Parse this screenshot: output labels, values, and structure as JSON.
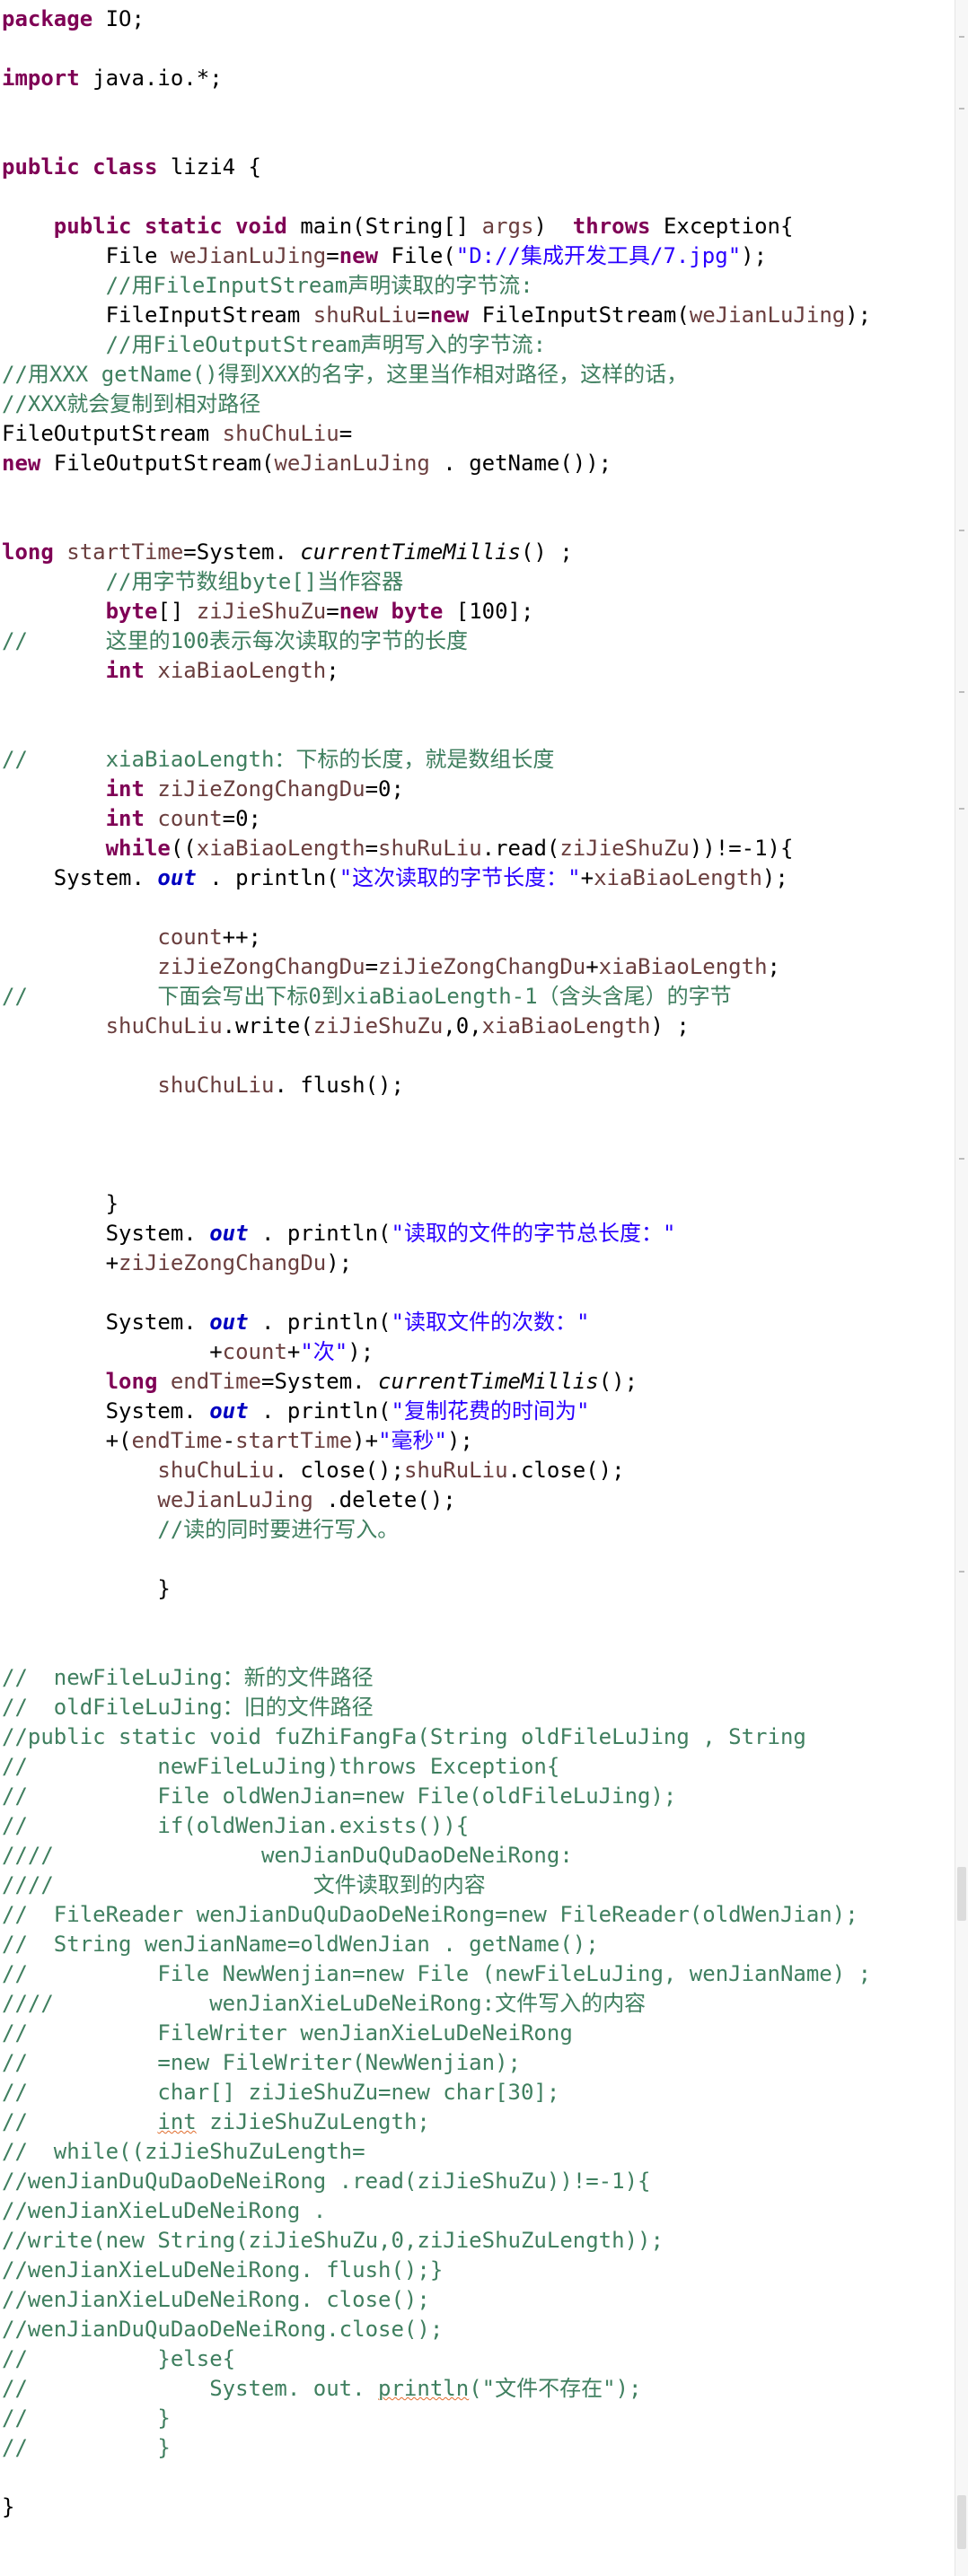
{
  "editor": {
    "lines": [
      [
        {
          "c": "kw",
          "t": "package"
        },
        {
          "c": "plain",
          "t": " IO;"
        }
      ],
      [],
      [
        {
          "c": "kw",
          "t": "import"
        },
        {
          "c": "plain",
          "t": " java.io.*;"
        }
      ],
      [],
      [],
      [
        {
          "c": "kw",
          "t": "public class"
        },
        {
          "c": "plain",
          "t": " lizi4 {"
        }
      ],
      [],
      [
        {
          "c": "plain",
          "t": "    "
        },
        {
          "c": "kw",
          "t": "public static void"
        },
        {
          "c": "plain",
          "t": " main(String[] "
        },
        {
          "c": "var",
          "t": "args"
        },
        {
          "c": "plain",
          "t": ")  "
        },
        {
          "c": "kw",
          "t": "throws"
        },
        {
          "c": "plain",
          "t": " Exception{"
        }
      ],
      [
        {
          "c": "plain",
          "t": "        File "
        },
        {
          "c": "var",
          "t": "weJianLuJing"
        },
        {
          "c": "plain",
          "t": "="
        },
        {
          "c": "kw",
          "t": "new"
        },
        {
          "c": "plain",
          "t": " File("
        },
        {
          "c": "st",
          "t": "\"D://集成开发工具/7.jpg\""
        },
        {
          "c": "plain",
          "t": ");"
        }
      ],
      [
        {
          "c": "plain",
          "t": "        "
        },
        {
          "c": "cm",
          "t": "//用FileInputStream声明读取的字节流:"
        }
      ],
      [
        {
          "c": "plain",
          "t": "        FileInputStream "
        },
        {
          "c": "var",
          "t": "shuRuLiu"
        },
        {
          "c": "plain",
          "t": "="
        },
        {
          "c": "kw",
          "t": "new"
        },
        {
          "c": "plain",
          "t": " FileInputStream("
        },
        {
          "c": "var",
          "t": "weJianLuJing"
        },
        {
          "c": "plain",
          "t": ");"
        }
      ],
      [
        {
          "c": "plain",
          "t": "        "
        },
        {
          "c": "cm",
          "t": "//用FileOutputStream声明写入的字节流:"
        }
      ],
      [
        {
          "c": "cm",
          "t": "//用XXX getName()得到XXX的名字，这里当作相对路径，这样的话，"
        }
      ],
      [
        {
          "c": "cm",
          "t": "//XXX就会复制到相对路径"
        }
      ],
      [
        {
          "c": "plain",
          "t": "FileOutputStream "
        },
        {
          "c": "var",
          "t": "shuChuLiu"
        },
        {
          "c": "plain",
          "t": "="
        }
      ],
      [
        {
          "c": "kw",
          "t": "new"
        },
        {
          "c": "plain",
          "t": " FileOutputStream("
        },
        {
          "c": "var",
          "t": "weJianLuJing"
        },
        {
          "c": "plain",
          "t": " . getName());"
        }
      ],
      [],
      [],
      [
        {
          "c": "kw",
          "t": "long"
        },
        {
          "c": "plain",
          "t": " "
        },
        {
          "c": "var",
          "t": "startTime"
        },
        {
          "c": "plain",
          "t": "=System. "
        },
        {
          "c": "it",
          "t": "currentTimeMillis"
        },
        {
          "c": "plain",
          "t": "() ;"
        }
      ],
      [
        {
          "c": "plain",
          "t": "        "
        },
        {
          "c": "cm",
          "t": "//用字节数组byte[]当作容器"
        }
      ],
      [
        {
          "c": "plain",
          "t": "        "
        },
        {
          "c": "kw",
          "t": "byte"
        },
        {
          "c": "plain",
          "t": "[] "
        },
        {
          "c": "var",
          "t": "ziJieShuZu"
        },
        {
          "c": "plain",
          "t": "="
        },
        {
          "c": "kw",
          "t": "new byte"
        },
        {
          "c": "plain",
          "t": " [100];"
        }
      ],
      [
        {
          "c": "cm",
          "t": "//      这里的100表示每次读取的字节的长度"
        }
      ],
      [
        {
          "c": "plain",
          "t": "        "
        },
        {
          "c": "kw",
          "t": "int"
        },
        {
          "c": "plain",
          "t": " "
        },
        {
          "c": "var",
          "t": "xiaBiaoLength"
        },
        {
          "c": "plain",
          "t": ";"
        }
      ],
      [],
      [],
      [
        {
          "c": "cm",
          "t": "//      xiaBiaoLength：下标的长度，就是数组长度"
        }
      ],
      [
        {
          "c": "plain",
          "t": "        "
        },
        {
          "c": "kw",
          "t": "int"
        },
        {
          "c": "plain",
          "t": " "
        },
        {
          "c": "var",
          "t": "ziJieZongChangDu"
        },
        {
          "c": "plain",
          "t": "=0;"
        }
      ],
      [
        {
          "c": "plain",
          "t": "        "
        },
        {
          "c": "kw",
          "t": "int"
        },
        {
          "c": "plain",
          "t": " "
        },
        {
          "c": "var",
          "t": "count"
        },
        {
          "c": "plain",
          "t": "=0;"
        }
      ],
      [
        {
          "c": "plain",
          "t": "        "
        },
        {
          "c": "kw",
          "t": "while"
        },
        {
          "c": "plain",
          "t": "(("
        },
        {
          "c": "var",
          "t": "xiaBiaoLength"
        },
        {
          "c": "plain",
          "t": "="
        },
        {
          "c": "var",
          "t": "shuRuLiu"
        },
        {
          "c": "plain",
          "t": ".read("
        },
        {
          "c": "var",
          "t": "ziJieShuZu"
        },
        {
          "c": "plain",
          "t": "))!=-1){"
        }
      ],
      [
        {
          "c": "plain",
          "t": "    System. "
        },
        {
          "c": "fd",
          "t": "out"
        },
        {
          "c": "plain",
          "t": " . println("
        },
        {
          "c": "st",
          "t": "\"这次读取的字节长度：\""
        },
        {
          "c": "plain",
          "t": "+"
        },
        {
          "c": "var",
          "t": "xiaBiaoLength"
        },
        {
          "c": "plain",
          "t": ");"
        }
      ],
      [],
      [
        {
          "c": "plain",
          "t": "            "
        },
        {
          "c": "var",
          "t": "count"
        },
        {
          "c": "plain",
          "t": "++;"
        }
      ],
      [
        {
          "c": "plain",
          "t": "            "
        },
        {
          "c": "var",
          "t": "ziJieZongChangDu"
        },
        {
          "c": "plain",
          "t": "="
        },
        {
          "c": "var",
          "t": "ziJieZongChangDu"
        },
        {
          "c": "plain",
          "t": "+"
        },
        {
          "c": "var",
          "t": "xiaBiaoLength"
        },
        {
          "c": "plain",
          "t": ";"
        }
      ],
      [
        {
          "c": "cm",
          "t": "//          下面会写出下标0到xiaBiaoLength-1（含头含尾）的字节"
        }
      ],
      [
        {
          "c": "plain",
          "t": "        "
        },
        {
          "c": "var",
          "t": "shuChuLiu"
        },
        {
          "c": "plain",
          "t": ".write("
        },
        {
          "c": "var",
          "t": "ziJieShuZu"
        },
        {
          "c": "plain",
          "t": ",0,"
        },
        {
          "c": "var",
          "t": "xiaBiaoLength"
        },
        {
          "c": "plain",
          "t": ") ;"
        }
      ],
      [],
      [
        {
          "c": "plain",
          "t": "            "
        },
        {
          "c": "var",
          "t": "shuChuLiu"
        },
        {
          "c": "plain",
          "t": ". flush();"
        }
      ],
      [],
      [],
      [],
      [
        {
          "c": "plain",
          "t": "        }"
        }
      ],
      [
        {
          "c": "plain",
          "t": "        System. "
        },
        {
          "c": "fd",
          "t": "out"
        },
        {
          "c": "plain",
          "t": " . println("
        },
        {
          "c": "st",
          "t": "\"读取的文件的字节总长度：\""
        }
      ],
      [
        {
          "c": "plain",
          "t": "        +"
        },
        {
          "c": "var",
          "t": "ziJieZongChangDu"
        },
        {
          "c": "plain",
          "t": ");"
        }
      ],
      [],
      [
        {
          "c": "plain",
          "t": "        System. "
        },
        {
          "c": "fd",
          "t": "out"
        },
        {
          "c": "plain",
          "t": " . println("
        },
        {
          "c": "st",
          "t": "\"读取文件的次数：\""
        }
      ],
      [
        {
          "c": "plain",
          "t": "                +"
        },
        {
          "c": "var",
          "t": "count"
        },
        {
          "c": "plain",
          "t": "+"
        },
        {
          "c": "st",
          "t": "\"次\""
        },
        {
          "c": "plain",
          "t": ");"
        }
      ],
      [
        {
          "c": "plain",
          "t": "        "
        },
        {
          "c": "kw",
          "t": "long"
        },
        {
          "c": "plain",
          "t": " "
        },
        {
          "c": "var",
          "t": "endTime"
        },
        {
          "c": "plain",
          "t": "=System. "
        },
        {
          "c": "it",
          "t": "currentTimeMillis"
        },
        {
          "c": "plain",
          "t": "();"
        }
      ],
      [
        {
          "c": "plain",
          "t": "        System. "
        },
        {
          "c": "fd",
          "t": "out"
        },
        {
          "c": "plain",
          "t": " . println("
        },
        {
          "c": "st",
          "t": "\"复制花费的时间为\""
        }
      ],
      [
        {
          "c": "plain",
          "t": "        +("
        },
        {
          "c": "var",
          "t": "endTime"
        },
        {
          "c": "plain",
          "t": "-"
        },
        {
          "c": "var",
          "t": "startTime"
        },
        {
          "c": "plain",
          "t": ")+"
        },
        {
          "c": "st",
          "t": "\"毫秒\""
        },
        {
          "c": "plain",
          "t": ");"
        }
      ],
      [
        {
          "c": "plain",
          "t": "            "
        },
        {
          "c": "var",
          "t": "shuChuLiu"
        },
        {
          "c": "plain",
          "t": ". close();"
        },
        {
          "c": "var",
          "t": "shuRuLiu"
        },
        {
          "c": "plain",
          "t": ".close();"
        }
      ],
      [
        {
          "c": "plain",
          "t": "            "
        },
        {
          "c": "var",
          "t": "weJianLuJing"
        },
        {
          "c": "plain",
          "t": " .delete();"
        }
      ],
      [
        {
          "c": "plain",
          "t": "            "
        },
        {
          "c": "cm",
          "t": "//读的同时要进行写入。"
        }
      ],
      [],
      [
        {
          "c": "plain",
          "t": "            }"
        }
      ],
      [],
      [],
      [
        {
          "c": "cm",
          "t": "//  newFileLuJing：新的文件路径"
        }
      ],
      [
        {
          "c": "cm",
          "t": "//  oldFileLuJing：旧的文件路径"
        }
      ],
      [
        {
          "c": "cm",
          "t": "//public static void fuZhiFangFa(String oldFileLuJing , String"
        }
      ],
      [
        {
          "c": "cm",
          "t": "//          newFileLuJing)throws Exception{"
        }
      ],
      [
        {
          "c": "cm",
          "t": "//          File oldWenJian=new File(oldFileLuJing);"
        }
      ],
      [
        {
          "c": "cm",
          "t": "//          if(oldWenJian.exists()){"
        }
      ],
      [
        {
          "c": "cm",
          "t": "////                wenJianDuQuDaoDeNeiRong:"
        }
      ],
      [
        {
          "c": "cm",
          "t": "////                    文件读取到的内容"
        }
      ],
      [
        {
          "c": "cm",
          "t": "//  FileReader wenJianDuQuDaoDeNeiRong=new FileReader(oldWenJian);"
        }
      ],
      [
        {
          "c": "cm",
          "t": "//  String wenJianName=oldWenJian . getName();"
        }
      ],
      [
        {
          "c": "cm",
          "t": "//          File NewWenjian=new File (newFileLuJing, wenJianName) ;"
        }
      ],
      [
        {
          "c": "cm",
          "t": "////            wenJianXieLuDeNeiRong:文件写入的内容"
        }
      ],
      [
        {
          "c": "cm",
          "t": "//          FileWriter wenJianXieLuDeNeiRong"
        }
      ],
      [
        {
          "c": "cm",
          "t": "//          =new FileWriter(NewWenjian);"
        }
      ],
      [
        {
          "c": "cm",
          "t": "//          char[] ziJieShuZu=new char[30];"
        }
      ],
      [
        {
          "c": "cm",
          "t": "//          "
        },
        {
          "c": "cm squiggle",
          "t": "int"
        },
        {
          "c": "cm",
          "t": " ziJieShuZuLength;"
        }
      ],
      [
        {
          "c": "cm",
          "t": "//  while((ziJieShuZuLength="
        }
      ],
      [
        {
          "c": "cm",
          "t": "//wenJianDuQuDaoDeNeiRong .read(ziJieShuZu))!=-1){"
        }
      ],
      [
        {
          "c": "cm",
          "t": "//wenJianXieLuDeNeiRong ."
        }
      ],
      [
        {
          "c": "cm",
          "t": "//write(new String(ziJieShuZu,0,ziJieShuZuLength));"
        }
      ],
      [
        {
          "c": "cm",
          "t": "//wenJianXieLuDeNeiRong. flush();}"
        }
      ],
      [
        {
          "c": "cm",
          "t": "//wenJianXieLuDeNeiRong. close();"
        }
      ],
      [
        {
          "c": "cm",
          "t": "//wenJianDuQuDaoDeNeiRong.close();"
        }
      ],
      [
        {
          "c": "cm",
          "t": "//          }else{"
        }
      ],
      [
        {
          "c": "cm",
          "t": "//              System. out. "
        },
        {
          "c": "cm squiggle",
          "t": "println"
        },
        {
          "c": "cm",
          "t": "(\"文件不存在\");"
        }
      ],
      [
        {
          "c": "cm",
          "t": "//          }"
        }
      ],
      [
        {
          "c": "cm",
          "t": "//          }"
        }
      ],
      [],
      [
        {
          "c": "plain",
          "t": "}"
        }
      ]
    ]
  }
}
